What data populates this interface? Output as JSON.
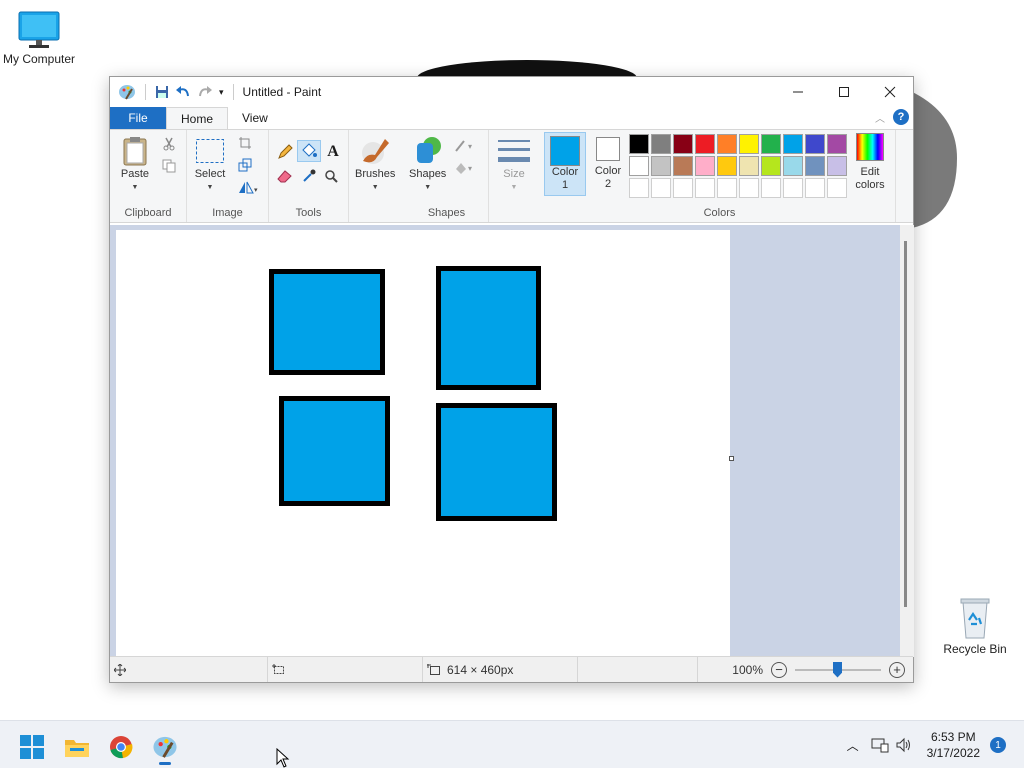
{
  "desktop": {
    "my_computer_label": "My Computer",
    "recycle_bin_label": "Recycle Bin"
  },
  "window": {
    "title": "Untitled - Paint"
  },
  "menu": {
    "file": "File",
    "home": "Home",
    "view": "View"
  },
  "ribbon": {
    "clipboard": {
      "paste": "Paste",
      "group": "Clipboard"
    },
    "image": {
      "select": "Select",
      "group": "Image"
    },
    "tools": {
      "group": "Tools"
    },
    "shapes": {
      "brushes": "Brushes",
      "shapes": "Shapes",
      "group": "Shapes"
    },
    "size": {
      "label": "Size"
    },
    "colors": {
      "color1_label": "Color\n1",
      "color1_line1": "Color",
      "color1_line2": "1",
      "color2_line1": "Color",
      "color2_line2": "2",
      "edit_line1": "Edit",
      "edit_line2": "colors",
      "group": "Colors",
      "color1_value": "#00a2e8",
      "color2_value": "#ffffff",
      "palette_row1": [
        "#000000",
        "#7f7f7f",
        "#880015",
        "#ed1c24",
        "#ff7f27",
        "#fff200",
        "#22b14c",
        "#00a2e8",
        "#3f48cc",
        "#a349a4"
      ],
      "palette_row2": [
        "#ffffff",
        "#c3c3c3",
        "#b97a57",
        "#ffaec9",
        "#ffc90e",
        "#efe4b0",
        "#b5e61d",
        "#99d9ea",
        "#7092be",
        "#c8bfe7"
      ]
    }
  },
  "canvas": {
    "fill_color": "#00a2e8",
    "stroke_color": "#000000"
  },
  "status": {
    "dimensions": "614 × 460px",
    "zoom": "100%"
  },
  "taskbar": {
    "time": "6:53 PM",
    "date": "3/17/2022",
    "notifications": "1"
  }
}
